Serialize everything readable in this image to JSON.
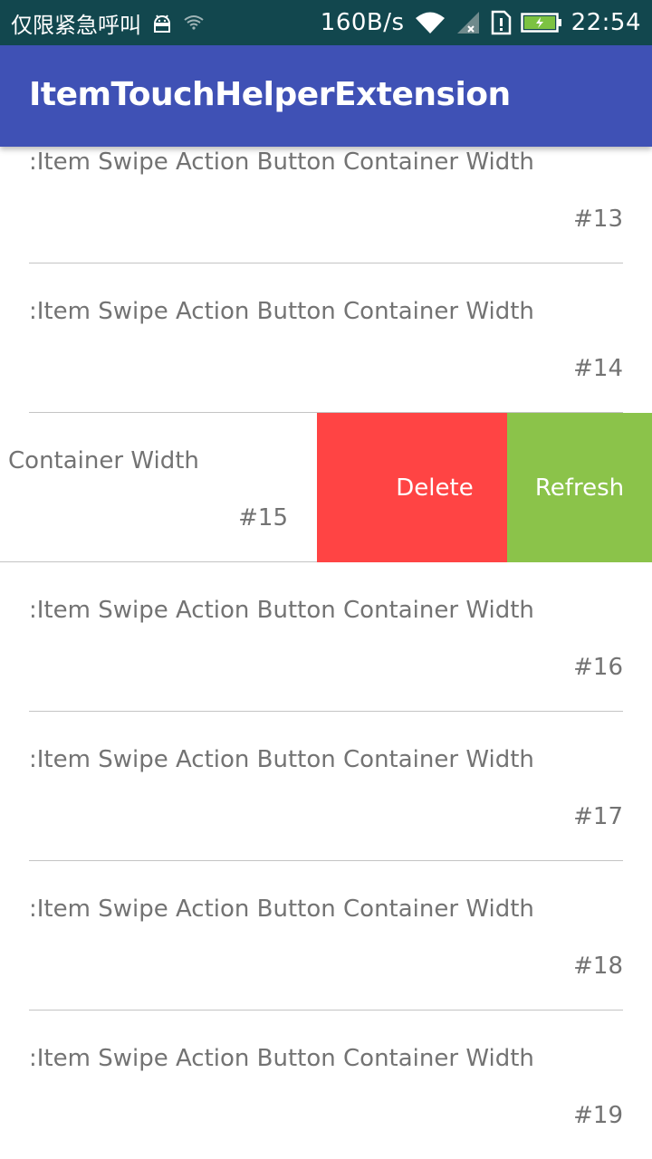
{
  "status_bar": {
    "carrier": "仅限紧急呼叫",
    "speed": "160B/s",
    "time": "22:54",
    "icons": [
      "android-debug-icon",
      "wifi-icon",
      "wifi-signal-icon",
      "cellular-no-signal-icon",
      "sim-alert-icon",
      "battery-charging-icon"
    ]
  },
  "app_bar": {
    "title": "ItemTouchHelperExtension",
    "color": "#3f51b5"
  },
  "list": {
    "items": [
      {
        "title": ":Item Swipe Action Button Container Width",
        "number": "#13"
      },
      {
        "title": ":Item Swipe Action Button Container Width",
        "number": "#14"
      },
      {
        "title": ":Item Swipe Action Button Container Width",
        "number": "#15",
        "swiped": true
      },
      {
        "title": ":Item Swipe Action Button Container Width",
        "number": "#16"
      },
      {
        "title": ":Item Swipe Action Button Container Width",
        "number": "#17"
      },
      {
        "title": ":Item Swipe Action Button Container Width",
        "number": "#18"
      },
      {
        "title": ":Item Swipe Action Button Container Width",
        "number": "#19"
      }
    ]
  },
  "swipe_actions": {
    "delete_label": "Delete",
    "refresh_label": "Refresh",
    "delete_color": "#ff4444",
    "refresh_color": "#8bc34a"
  }
}
